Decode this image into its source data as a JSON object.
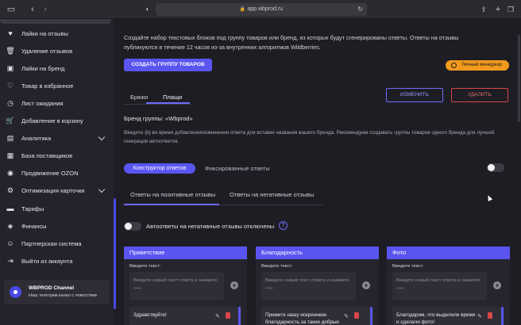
{
  "browser": {
    "url": "app.wbprod.ru",
    "lock_icon": "lock-icon"
  },
  "sidebar": {
    "items": [
      {
        "label": "Лайки на отзывы",
        "icon": "heart-icon"
      },
      {
        "label": "Удаление отзывов",
        "icon": "trash-icon"
      },
      {
        "label": "Лайки на бренд",
        "icon": "heart-box-icon"
      },
      {
        "label": "Товар в избранное",
        "icon": "heart-plus-icon"
      },
      {
        "label": "Лист ожидания",
        "icon": "clock-icon"
      },
      {
        "label": "Добавление в корзину",
        "icon": "cart-icon"
      },
      {
        "label": "Аналитика",
        "icon": "chart-icon",
        "expandable": true
      },
      {
        "label": "База поставщиков",
        "icon": "database-icon"
      },
      {
        "label": "Продвижение OZON",
        "icon": "ozon-icon"
      },
      {
        "label": "Оптимизация карточки",
        "icon": "gear-icon",
        "expandable": true
      },
      {
        "label": "Тарифы",
        "icon": "wallet-icon"
      },
      {
        "label": "Финансы",
        "icon": "finance-icon"
      },
      {
        "label": "Партнерская система",
        "icon": "user-plus-icon"
      },
      {
        "label": "Выйти из аккаунта",
        "icon": "logout-icon"
      }
    ],
    "channel": {
      "title": "WBPROD Channel",
      "subtitle": "Наш телеграм канал с новостями"
    }
  },
  "main": {
    "info_text": "Создайте набор текстовых блоков под группу товаров или бренд, из которых будут сгенерированы ответы. Ответы на отзывы публикуются в течение 12 часов из-за внутренних алгоритмов Wildberries.",
    "create_group_button": "СОЗДАТЬ ГРУППУ ТОВАРОВ",
    "manager_button": "Личный менеджер",
    "group_tabs": [
      "Брюки",
      "Плащи"
    ],
    "edit_button": "ИЗМЕНИТЬ",
    "delete_button": "УДАЛИТЬ",
    "brand_label": "Бренд группы: «Wbprod»",
    "hint_text": "Введите {b} во время добавления/изменения ответа для вставки названия вашего бренда. Рекомендуем создавать группы товаров одного бренда для лучшей генерации автоответов.",
    "mode_tabs": {
      "active": "Конструктор ответов",
      "inactive": "Фиксированные ответы"
    },
    "review_tabs": {
      "positive": "Ответы на позитивные отзывы",
      "negative": "Ответы на негативные отзывы"
    },
    "autoreply_text": "Автоответы на негативные отзывы отключены",
    "help_mark": "?",
    "cards": [
      {
        "title": "Приветствие",
        "label": "Введите текст:",
        "placeholder": "Введите новый текст ответа и нажмите «+»",
        "item": "Здравствуйте!"
      },
      {
        "title": "Благодарность",
        "label": "Введите текст:",
        "placeholder": "Введите новый текст ответа и нажмите «+»",
        "item": "Примите нашу искреннюю благодарность за такие добрые"
      },
      {
        "title": "Фото",
        "label": "Введите текст:",
        "placeholder": "Введите новый текст ответа и нажмите «+»",
        "item": "Благодарим, что выделили время и сделали фото!"
      }
    ]
  },
  "colors": {
    "accent": "#5a55f0",
    "danger": "#d94646",
    "manager": "#f39a1d",
    "background": "#1e1d24",
    "sidebar": "#24232b"
  }
}
